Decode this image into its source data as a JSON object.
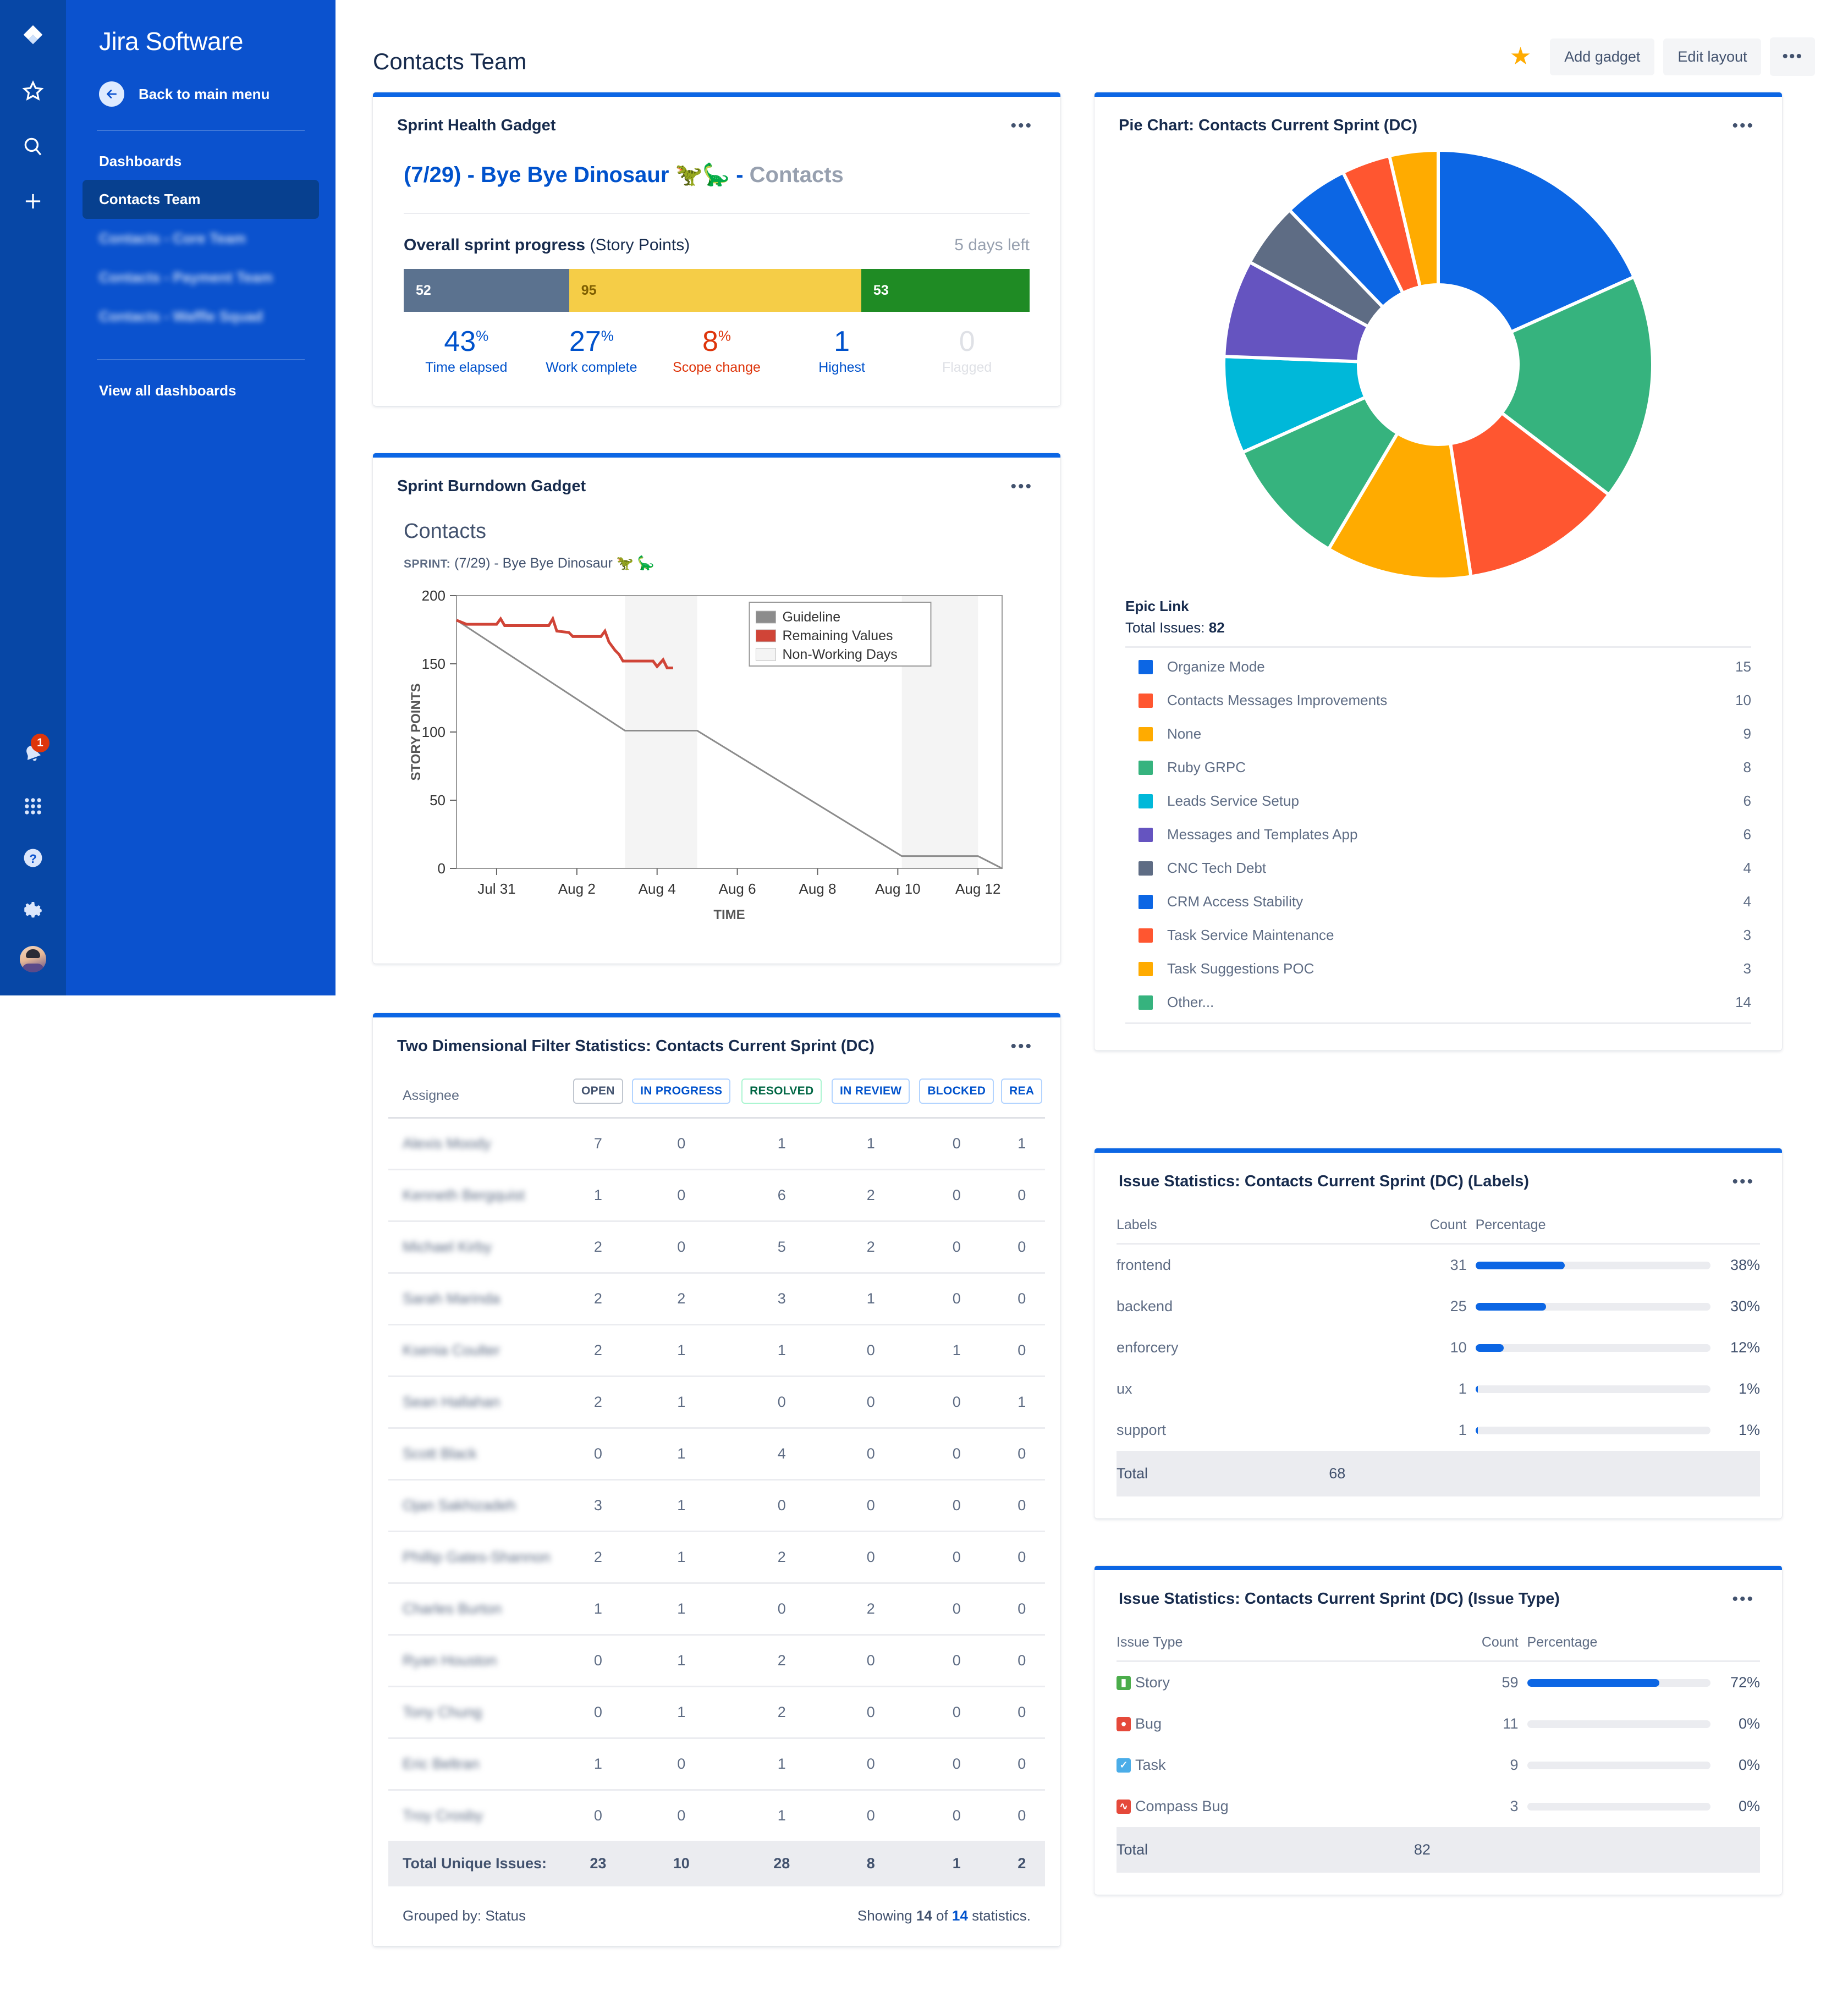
{
  "rail": {
    "icons": [
      "jira-logo-icon",
      "star-icon",
      "search-icon",
      "plus-icon"
    ],
    "bottom_icons": [
      "notification-bell-icon",
      "apps-grid-icon",
      "help-icon",
      "settings-gear-icon",
      "avatar"
    ],
    "notification_count": "1"
  },
  "sidebar": {
    "brand": "Jira Software",
    "back_label": "Back to main menu",
    "section_title": "Dashboards",
    "items": [
      {
        "label": "Contacts Team",
        "active": true,
        "blurred": false
      },
      {
        "label": "Contacts - Core Team",
        "active": false,
        "blurred": true
      },
      {
        "label": "Contacts - Payment Team",
        "active": false,
        "blurred": true
      },
      {
        "label": "Contacts - Waffle Squad",
        "active": false,
        "blurred": true
      }
    ],
    "view_all": "View all dashboards"
  },
  "header": {
    "title": "Contacts Team",
    "star_icon": "star-filled-icon",
    "add_gadget": "Add gadget",
    "edit_layout": "Edit layout",
    "more": "•••"
  },
  "sprint_health": {
    "title": "Sprint Health Gadget",
    "more": "•••",
    "sprint_link": "(7/29) - Bye Bye Dinosaur 🦖🦕 -",
    "sprint_suffix": "Contacts",
    "progress_title_bold": "Overall sprint progress",
    "progress_title_regular": "(Story Points)",
    "days_left": "5 days left",
    "segments": [
      {
        "value": "52",
        "color": "#5b728f",
        "text_color": "#ffffff",
        "flex": 52
      },
      {
        "value": "95",
        "color": "#f5cd47",
        "text_color": "#7f5f01",
        "flex": 95
      },
      {
        "value": "53",
        "color": "#1f8b24",
        "text_color": "#ffffff",
        "flex": 53
      }
    ],
    "stats": [
      {
        "number": "43",
        "pct": "%",
        "label": "Time elapsed",
        "color": "#0052cc"
      },
      {
        "number": "27",
        "pct": "%",
        "label": "Work complete",
        "color": "#0052cc"
      },
      {
        "number": "8",
        "pct": "%",
        "label": "Scope change",
        "color": "#de350b"
      },
      {
        "number": "1",
        "pct": "",
        "label": "Highest",
        "color": "#0052cc"
      },
      {
        "number": "0",
        "pct": "",
        "label": "Flagged",
        "color": "#dfe1e6"
      }
    ]
  },
  "burndown": {
    "title": "Sprint Burndown Gadget",
    "more": "•••",
    "board": "Contacts",
    "sprint_prefix": "SPRINT:",
    "sprint_name": "(7/29) - Bye Bye Dinosaur 🦖 🦕"
  },
  "pie": {
    "title": "Pie Chart: Contacts Current Sprint (DC)",
    "more": "•••",
    "legend_header": "Epic Link",
    "total_label": "Total Issues:",
    "total_value": "82"
  },
  "two_dim": {
    "title": "Two Dimensional Filter Statistics: Contacts Current Sprint (DC)",
    "more": "•••",
    "row_header": "Assignee",
    "columns": [
      {
        "label": "OPEN",
        "style": "gray"
      },
      {
        "label": "IN PROGRESS",
        "style": "blue"
      },
      {
        "label": "RESOLVED",
        "style": "green"
      },
      {
        "label": "IN REVIEW",
        "style": "blue"
      },
      {
        "label": "BLOCKED",
        "style": "blue"
      },
      {
        "label": "REA",
        "style": "blue"
      }
    ],
    "rows": [
      {
        "name": "Alexis Moody",
        "values": [
          "7",
          "0",
          "1",
          "1",
          "0",
          "1"
        ]
      },
      {
        "name": "Kenneth Bergquist",
        "values": [
          "1",
          "0",
          "6",
          "2",
          "0",
          "0"
        ]
      },
      {
        "name": "Michael Kirby",
        "values": [
          "2",
          "0",
          "5",
          "2",
          "0",
          "0"
        ]
      },
      {
        "name": "Sarah Marinda",
        "values": [
          "2",
          "2",
          "3",
          "1",
          "0",
          "0"
        ]
      },
      {
        "name": "Ksenia Coulter",
        "values": [
          "2",
          "1",
          "1",
          "0",
          "1",
          "0"
        ]
      },
      {
        "name": "Sean Hallahan",
        "values": [
          "2",
          "1",
          "0",
          "0",
          "0",
          "1"
        ]
      },
      {
        "name": "Scott Black",
        "values": [
          "0",
          "1",
          "4",
          "0",
          "0",
          "0"
        ]
      },
      {
        "name": "Ojan Sakhizadeh",
        "values": [
          "3",
          "1",
          "0",
          "0",
          "0",
          "0"
        ]
      },
      {
        "name": "Phillip Gates-Shannon",
        "values": [
          "2",
          "1",
          "2",
          "0",
          "0",
          "0"
        ]
      },
      {
        "name": "Charles Burton",
        "values": [
          "1",
          "1",
          "0",
          "2",
          "0",
          "0"
        ]
      },
      {
        "name": "Ryan Houston",
        "values": [
          "0",
          "1",
          "2",
          "0",
          "0",
          "0"
        ]
      },
      {
        "name": "Tony Chung",
        "values": [
          "0",
          "1",
          "2",
          "0",
          "0",
          "0"
        ]
      },
      {
        "name": "Eric Beltran",
        "values": [
          "1",
          "0",
          "1",
          "0",
          "0",
          "0"
        ]
      },
      {
        "name": "Troy Crosby",
        "values": [
          "0",
          "0",
          "1",
          "0",
          "0",
          "0"
        ]
      }
    ],
    "total_label": "Total Unique Issues:",
    "totals": [
      "23",
      "10",
      "28",
      "8",
      "1",
      "2"
    ],
    "grouped_by": "Grouped by: Status",
    "showing_prefix": "Showing",
    "showing_count": "14",
    "showing_of": "of",
    "showing_total": "14",
    "showing_suffix": "statistics."
  },
  "labels_stats": {
    "title": "Issue Statistics: Contacts Current Sprint (DC) (Labels)",
    "more": "•••",
    "col_label": "Labels",
    "col_count": "Count",
    "col_pct": "Percentage",
    "total_label": "Total",
    "total_value": "68"
  },
  "type_stats": {
    "title": "Issue Statistics: Contacts Current Sprint (DC) (Issue Type)",
    "more": "•••",
    "col_label": "Issue Type",
    "col_count": "Count",
    "col_pct": "Percentage",
    "total_label": "Total",
    "total_value": "82"
  },
  "chart_data": [
    {
      "type": "pie",
      "title": "Pie Chart: Contacts Current Sprint (DC)",
      "subtitle": "Epic Link",
      "total": 82,
      "donut": true,
      "legend_position": "bottom",
      "categories": [
        "Organize Mode",
        "Other...",
        "Contacts Messages Improvements",
        "None",
        "Ruby GRPC",
        "Leads Service Setup",
        "Messages and Templates App",
        "CNC Tech Debt",
        "CRM Access Stability",
        "Task Service Maintenance",
        "Task Suggestions POC"
      ],
      "values": [
        15,
        14,
        10,
        9,
        8,
        6,
        6,
        4,
        4,
        3,
        3
      ],
      "colors": [
        "#0c66e4",
        "#36b37e",
        "#ff5630",
        "#ffab00",
        "#36b37e",
        "#00b8d9",
        "#6554c0",
        "#5e6c84",
        "#0c66e4",
        "#ff5630",
        "#ffab00"
      ],
      "legend": [
        {
          "name": "Organize Mode",
          "value": "15",
          "color": "#0c66e4"
        },
        {
          "name": "Contacts Messages Improvements",
          "value": "10",
          "color": "#ff5630"
        },
        {
          "name": "None",
          "value": "9",
          "color": "#ffab00"
        },
        {
          "name": "Ruby GRPC",
          "value": "8",
          "color": "#36b37e"
        },
        {
          "name": "Leads Service Setup",
          "value": "6",
          "color": "#00b8d9"
        },
        {
          "name": "Messages and Templates App",
          "value": "6",
          "color": "#6554c0"
        },
        {
          "name": "CNC Tech Debt",
          "value": "4",
          "color": "#5e6c84"
        },
        {
          "name": "CRM Access Stability",
          "value": "4",
          "color": "#0c66e4"
        },
        {
          "name": "Task Service Maintenance",
          "value": "3",
          "color": "#ff5630"
        },
        {
          "name": "Task Suggestions POC",
          "value": "3",
          "color": "#ffab00"
        },
        {
          "name": "Other...",
          "value": "14",
          "color": "#36b37e"
        }
      ]
    },
    {
      "type": "line",
      "title": "Contacts",
      "subtitle": "SPRINT: (7/29) - Bye Bye Dinosaur 🦖 🦕",
      "xlabel": "TIME",
      "ylabel": "STORY POINTS",
      "ylim": [
        0,
        200
      ],
      "yticks": [
        0,
        50,
        100,
        150,
        200
      ],
      "xticks": [
        "Jul 31",
        "Aug 2",
        "Aug 4",
        "Aug 6",
        "Aug 8",
        "Aug 10",
        "Aug 12"
      ],
      "grid": false,
      "legend_position": "top-right",
      "series": [
        {
          "name": "Guideline",
          "color": "#8c8c8c",
          "points": [
            [
              0,
              182
            ],
            [
              4.2,
              101
            ],
            [
              6.0,
              101
            ],
            [
              11.1,
              9
            ],
            [
              13.0,
              9
            ],
            [
              13.6,
              0
            ]
          ]
        },
        {
          "name": "Remaining Values",
          "color": "#d04437",
          "points": [
            [
              0,
              182
            ],
            [
              0.25,
              179
            ],
            [
              1.0,
              179
            ],
            [
              1.1,
              183
            ],
            [
              1.2,
              178
            ],
            [
              2.3,
              178
            ],
            [
              2.4,
              183
            ],
            [
              2.5,
              174
            ],
            [
              2.8,
              173
            ],
            [
              2.9,
              170
            ],
            [
              3.6,
              170
            ],
            [
              3.7,
              174
            ],
            [
              3.8,
              166
            ],
            [
              3.95,
              160
            ],
            [
              4.05,
              157
            ],
            [
              4.15,
              152
            ],
            [
              4.9,
              152
            ],
            [
              5.0,
              148
            ],
            [
              5.15,
              153
            ],
            [
              5.25,
              147
            ],
            [
              5.4,
              147
            ]
          ]
        }
      ],
      "non_working_days": [
        [
          4.2,
          6.0
        ],
        [
          11.1,
          13.0
        ]
      ],
      "legend_entries": [
        {
          "name": "Guideline",
          "color": "#8c8c8c"
        },
        {
          "name": "Remaining Values",
          "color": "#d04437"
        },
        {
          "name": "Non-Working Days",
          "color": "#f4f4f4"
        }
      ]
    },
    {
      "type": "bar",
      "title": "Issue Statistics: Contacts Current Sprint (DC) (Labels)",
      "orientation": "horizontal",
      "categories": [
        "frontend",
        "backend",
        "enforcery",
        "ux",
        "support"
      ],
      "values": [
        31,
        25,
        10,
        1,
        1
      ],
      "percentages": [
        "38%",
        "30%",
        "12%",
        "1%",
        "1%"
      ],
      "bar_fill_pct": [
        38,
        30,
        12,
        1,
        1
      ],
      "total": 68,
      "color": "#0c66e4"
    },
    {
      "type": "bar",
      "title": "Issue Statistics: Contacts Current Sprint (DC) (Issue Type)",
      "orientation": "horizontal",
      "categories": [
        "Story",
        "Bug",
        "Task",
        "Compass Bug"
      ],
      "icons": [
        "story-icon",
        "bug-icon",
        "task-icon",
        "compass-bug-icon"
      ],
      "icon_colors": [
        "#4bad4b",
        "#e5493a",
        "#4bade8",
        "#e5493a"
      ],
      "values": [
        59,
        11,
        9,
        3
      ],
      "percentages": [
        "72%",
        "0%",
        "0%",
        "0%"
      ],
      "bar_fill_pct": [
        72,
        0,
        0,
        0
      ],
      "total": 82,
      "color": "#0c66e4"
    }
  ]
}
